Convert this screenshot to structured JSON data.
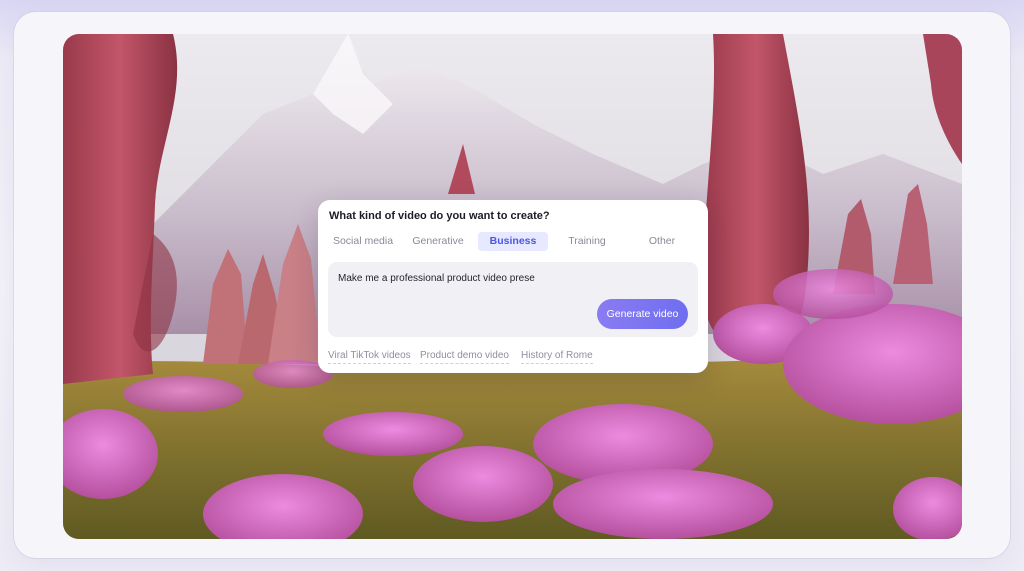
{
  "prompt_card": {
    "question": "What kind of video do you want to create?",
    "tabs": [
      {
        "label": "Social media",
        "active": false
      },
      {
        "label": "Generative",
        "active": false
      },
      {
        "label": "Business",
        "active": true
      },
      {
        "label": "Training",
        "active": false
      },
      {
        "label": "Other",
        "active": false
      }
    ],
    "prompt_value": "Make me a professional product video prese",
    "generate_label": "Generate video",
    "suggestions": [
      "Viral TikTok videos",
      "Product demo video",
      "History of Rome"
    ]
  },
  "colors": {
    "accent": "#6f6ef0",
    "tab_active_bg": "#e6e9ff",
    "tab_active_text": "#4b56e6"
  }
}
